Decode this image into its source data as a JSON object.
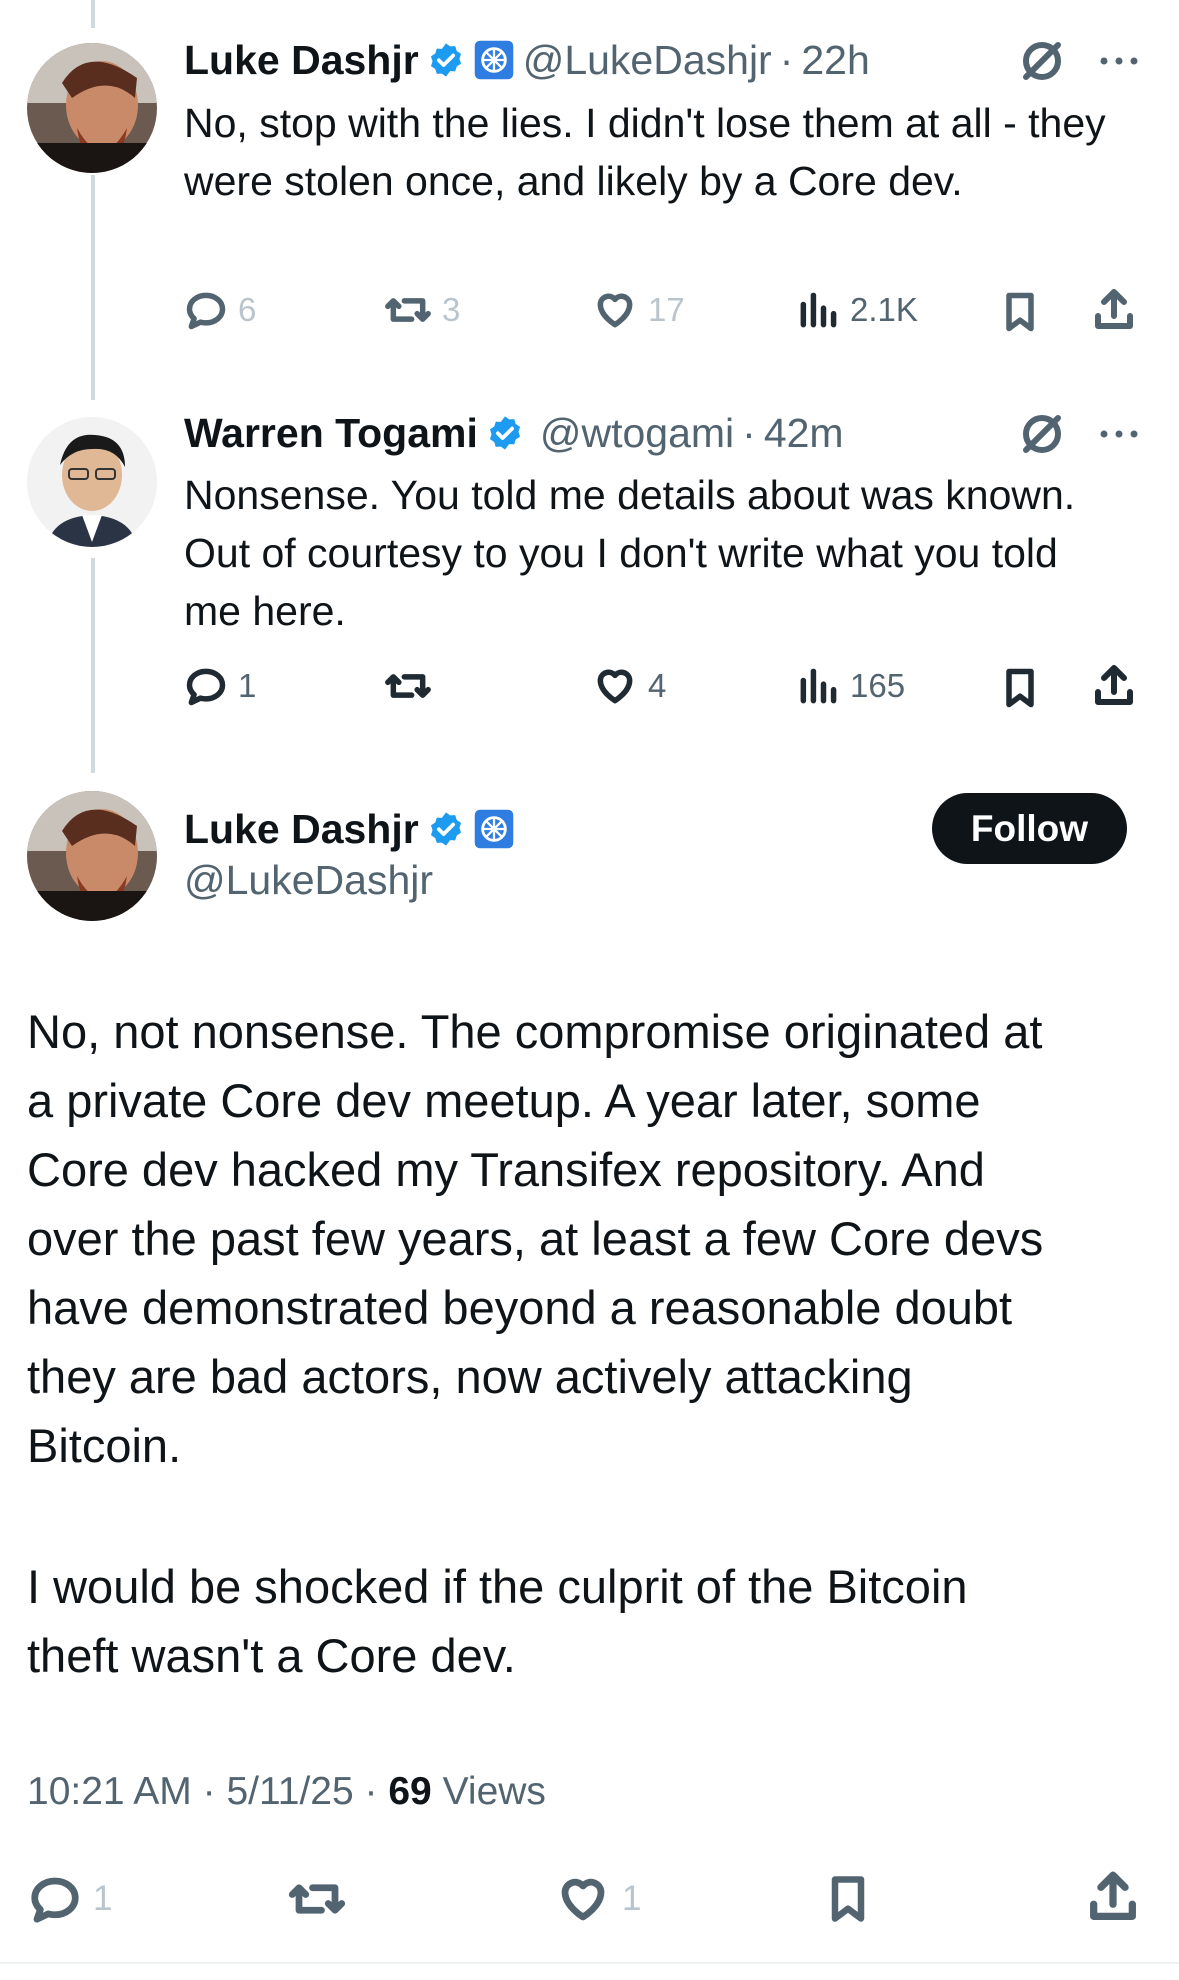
{
  "tweets": [
    {
      "name": "Luke Dashjr",
      "handle": "@LukeDashjr",
      "time": "22h",
      "text": "No, stop with the lies. I didn't lose them at all - they were stolen once, and likely by a Core dev.",
      "replies": "6",
      "reposts": "3",
      "likes": "17",
      "views": "2.1K"
    },
    {
      "name": "Warren Togami",
      "handle": "@wtogami",
      "time": "42m",
      "text": "Nonsense. You told me details about was known. Out of courtesy to you I don't write what you told me here.",
      "replies": "1",
      "reposts": "",
      "likes": "4",
      "views": "165"
    }
  ],
  "main": {
    "name": "Luke Dashjr",
    "handle": "@LukeDashjr",
    "follow_label": "Follow",
    "paragraph1": "No, not nonsense. The compromise originated at\na private Core dev meetup. A year later, some\nCore dev hacked my Transifex repository. And\nover the past few years, at least a few Core devs\nhave demonstrated beyond a reasonable doubt\nthey are bad actors, now actively attacking\nBitcoin.",
    "paragraph2": "I would be shocked if the culprit of the Bitcoin\ntheft wasn't a Core dev.",
    "time": "10:21 AM",
    "date": "5/11/25",
    "views_count": "69",
    "views_label": "Views",
    "replies": "1",
    "likes": "1"
  },
  "colors": {
    "verified": "#1d9bf0",
    "text": "#0f1419",
    "secondary": "#536471",
    "faded": "#b9c4cc"
  }
}
